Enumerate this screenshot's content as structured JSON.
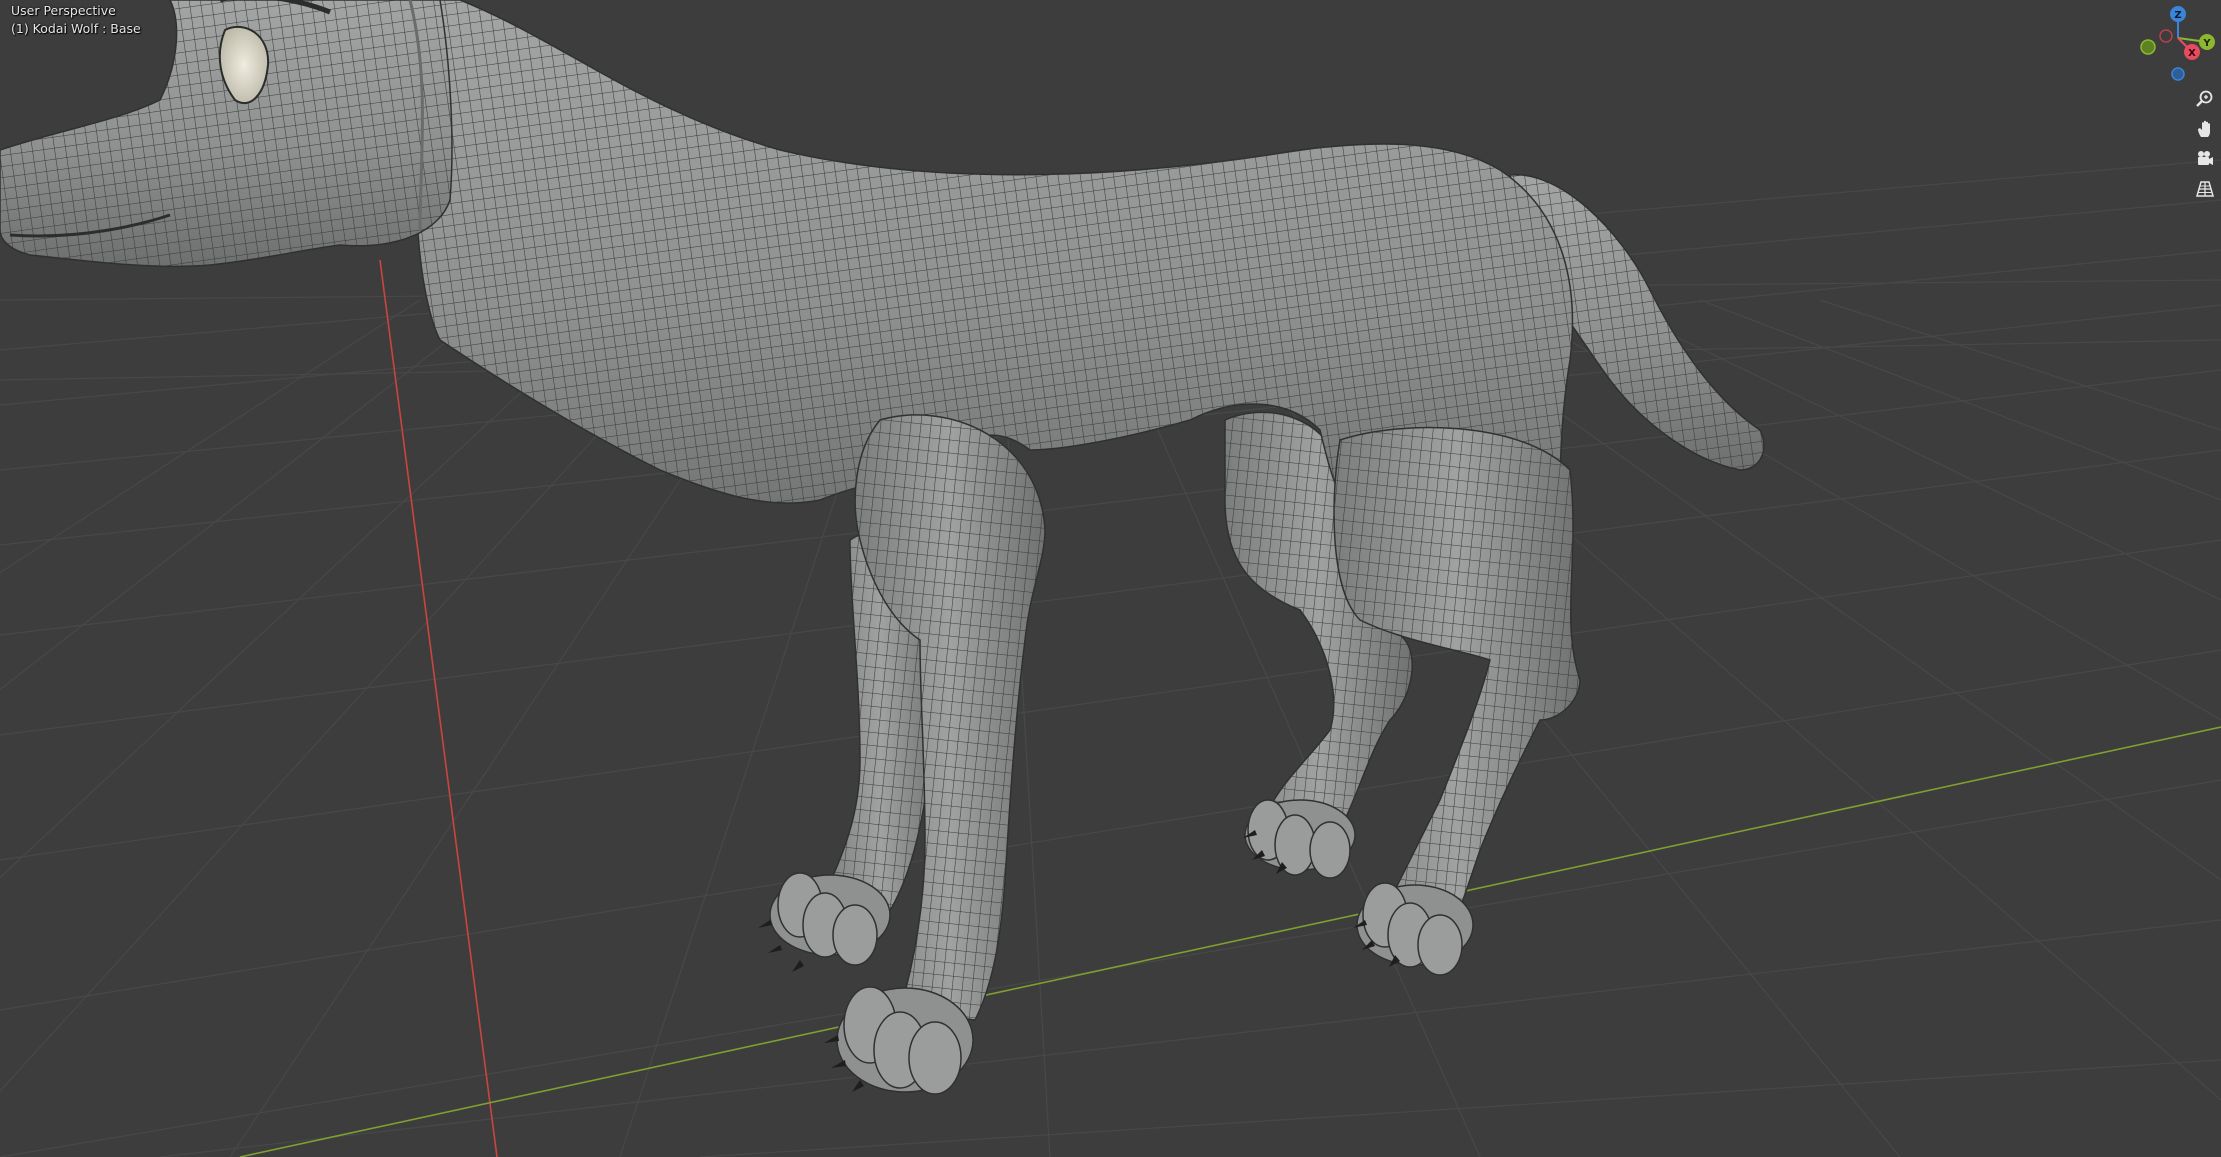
{
  "viewport": {
    "view_mode": "User Perspective",
    "active_object": "(1) Kodai Wolf : Base"
  },
  "gizmo": {
    "x_label": "X",
    "y_label": "Y",
    "z_label": "Z",
    "colors": {
      "x": "#e84a5f",
      "y": "#8cb72f",
      "z": "#3a84d9"
    }
  },
  "nav_icons": [
    "zoom-icon",
    "pan-hand-icon",
    "camera-icon",
    "perspective-grid-icon"
  ],
  "colors": {
    "background": "#3d3d3d",
    "grid": "#4a4a4a",
    "x_axis": "#c9453e",
    "y_axis": "#7fa030",
    "mesh": "#8f9190"
  }
}
